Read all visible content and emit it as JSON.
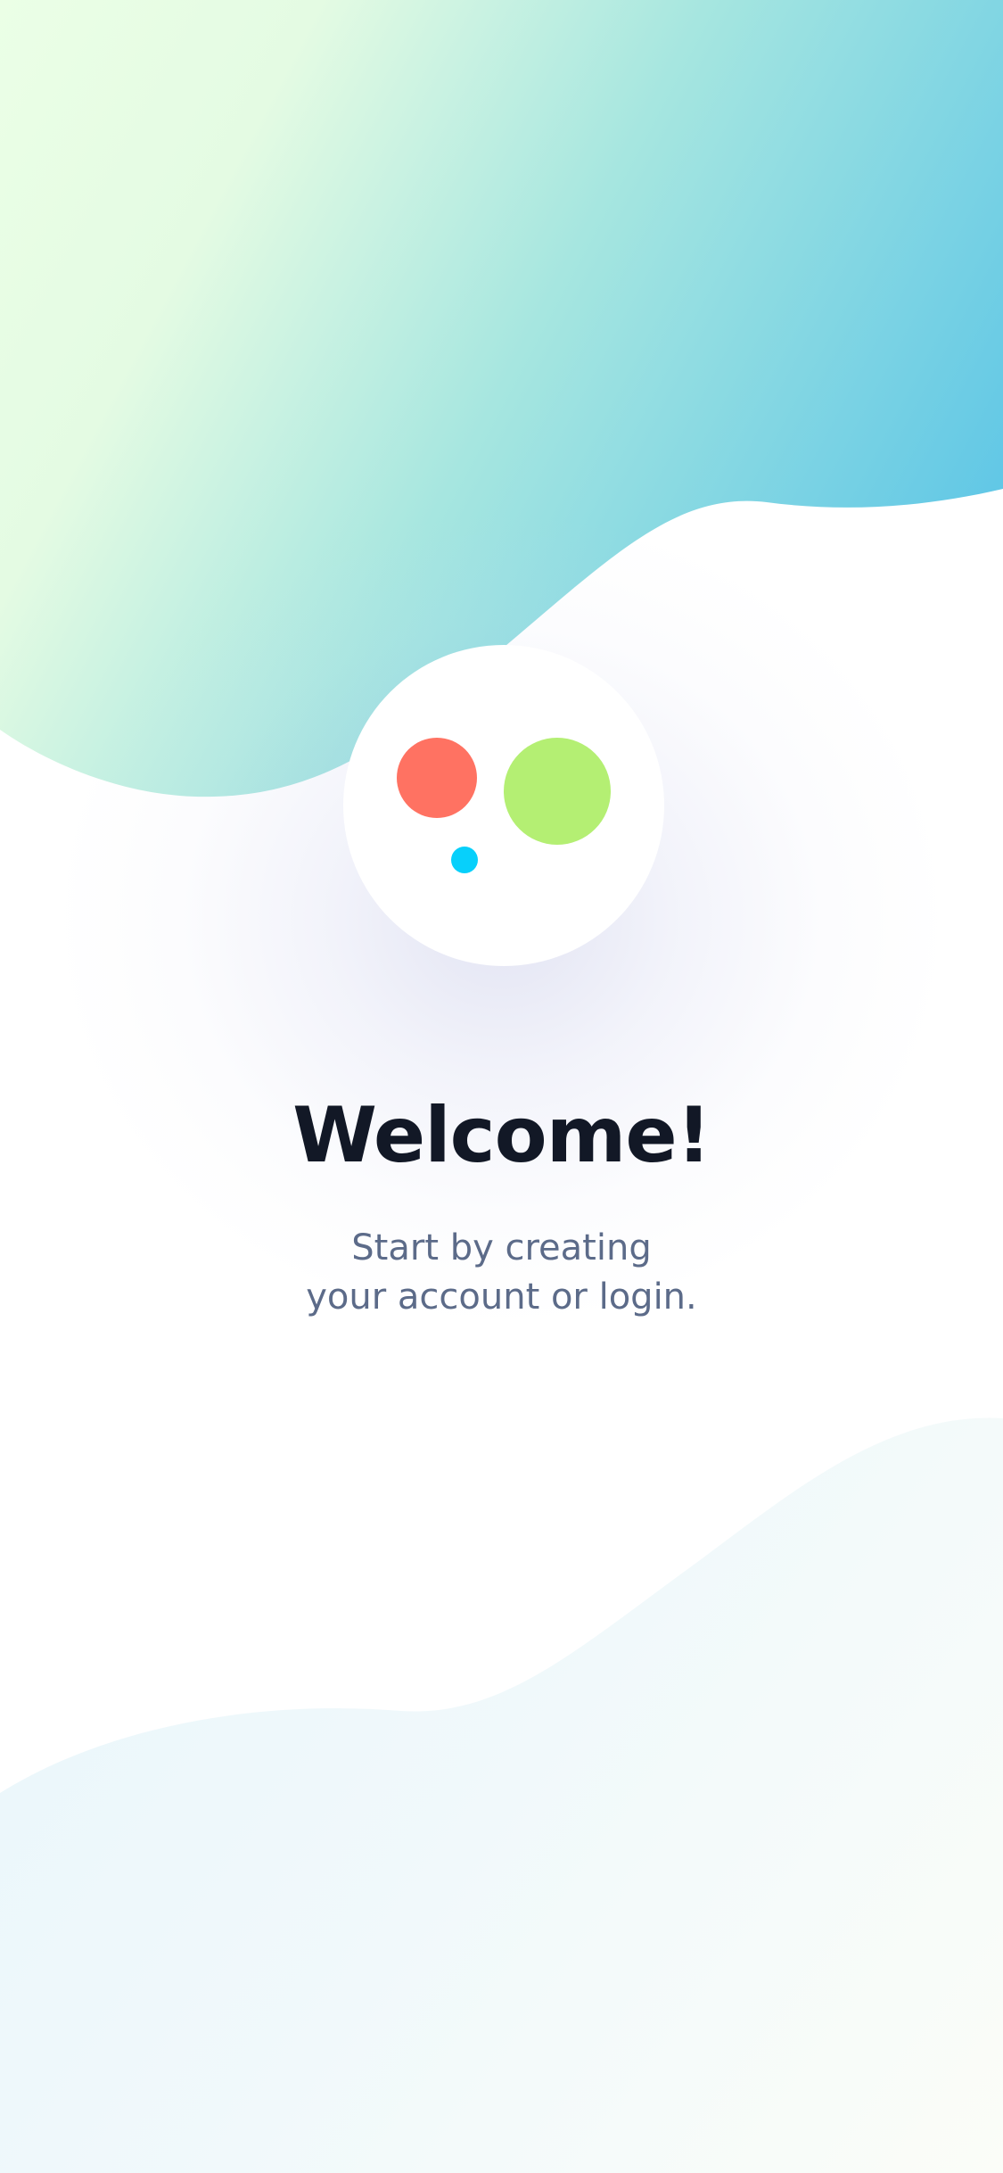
{
  "colors": {
    "title": "#121826",
    "subtitle": "#5c6b89",
    "dot_red": "#ff7262",
    "dot_green": "#b4ef73",
    "dot_blue": "#07d0fb",
    "wave_top_start": "#e8ffe4",
    "wave_top_end": "#5ec6e6"
  },
  "logo": {
    "icon": "app-logo-dots-icon"
  },
  "welcome": {
    "title": "Welcome!",
    "subtitle_line1": "Start by creating",
    "subtitle_line2": "your account or login."
  }
}
